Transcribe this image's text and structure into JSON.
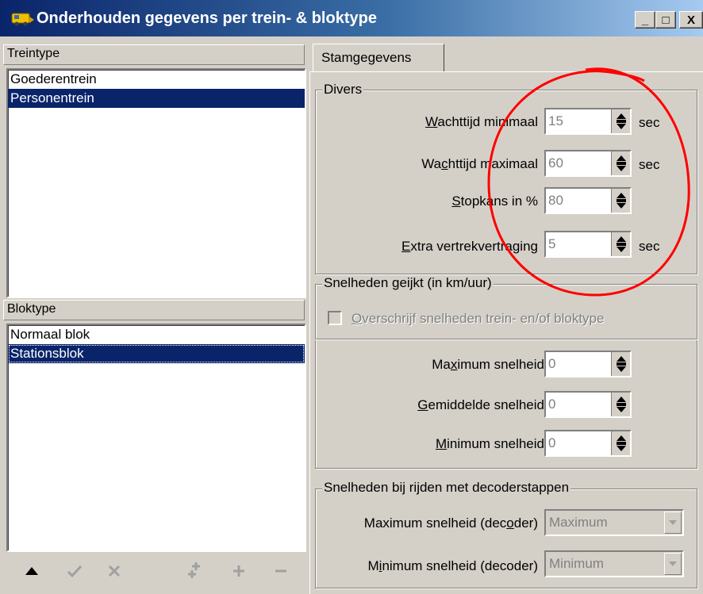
{
  "window": {
    "title": "Onderhouden gegevens per trein- & bloktype",
    "minimize_label": "_",
    "maximize_label": "□",
    "close_label": "X"
  },
  "treintype": {
    "header": "Treintype",
    "items": [
      "Goederentrein",
      "Personentrein"
    ],
    "selected": "Personentrein"
  },
  "bloktype": {
    "header": "Bloktype",
    "items": [
      "Normaal blok",
      "Stationsblok"
    ],
    "selected": "Stationsblok"
  },
  "toolbar": {
    "icons": [
      "move-up-icon",
      "confirm-icon",
      "cancel-icon",
      "copy-icon",
      "add-icon",
      "remove-icon"
    ]
  },
  "tabs": [
    {
      "label": "Stamgegevens"
    }
  ],
  "divers": {
    "legend": "Divers",
    "fields": [
      {
        "label_pre": "",
        "label_u": "W",
        "label_post": "achttijd minimaal",
        "value": "15",
        "unit": "sec"
      },
      {
        "label_pre": "Wa",
        "label_u": "c",
        "label_post": "httijd maximaal",
        "value": "60",
        "unit": "sec"
      },
      {
        "label_pre": "",
        "label_u": "S",
        "label_post": "topkans in %",
        "value": "80",
        "unit": ""
      },
      {
        "label_pre": "",
        "label_u": "E",
        "label_post": "xtra vertrekvertraging",
        "value": "5",
        "unit": "sec"
      }
    ]
  },
  "snelheden_geijkt": {
    "legend": "Snelheden geijkt (in km/uur)",
    "override": {
      "label_pre": "",
      "label_u": "O",
      "label_post": "verschrijf snelheden trein- en/of bloktype",
      "checked": false
    },
    "fields": [
      {
        "label_pre": "Ma",
        "label_u": "x",
        "label_post": "imum snelheid",
        "value": "0"
      },
      {
        "label_pre": "",
        "label_u": "G",
        "label_post": "emiddelde snelheid",
        "value": "0"
      },
      {
        "label_pre": "",
        "label_u": "M",
        "label_post": "inimum snelheid",
        "value": "0"
      }
    ]
  },
  "decoder": {
    "legend": "Snelheden bij rijden met decoderstappen",
    "fields": [
      {
        "label_pre": "Maximum snelheid (dec",
        "label_u": "o",
        "label_post": "der)",
        "value": "Maximum"
      },
      {
        "label_pre": "M",
        "label_u": "i",
        "label_post": "nimum snelheid (decoder)",
        "value": "Minimum"
      }
    ]
  },
  "annotation": {
    "color": "#ff0000"
  }
}
